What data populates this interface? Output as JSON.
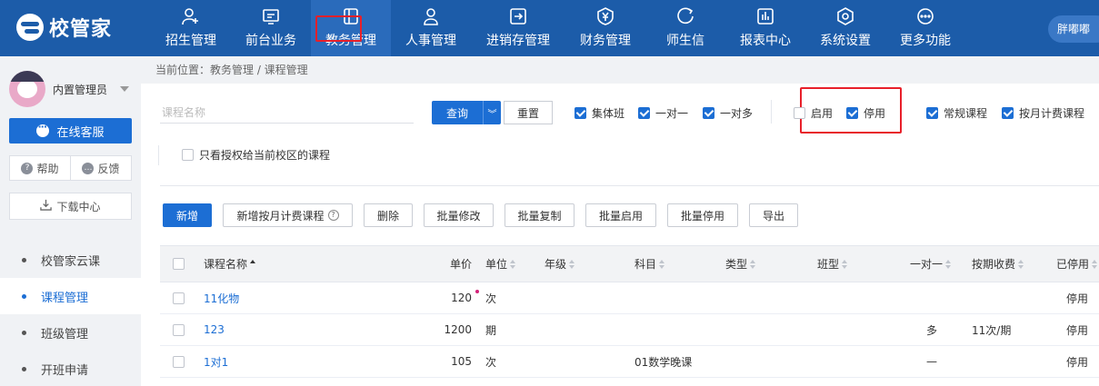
{
  "brand": {
    "name": "校管家"
  },
  "nav": {
    "items": [
      {
        "label": "招生管理",
        "icon": "person-add-icon"
      },
      {
        "label": "前台业务",
        "icon": "monitor-icon"
      },
      {
        "label": "教务管理",
        "icon": "book-icon",
        "active": true
      },
      {
        "label": "人事管理",
        "icon": "person-icon"
      },
      {
        "label": "进销存管理",
        "icon": "arrow-box-icon"
      },
      {
        "label": "财务管理",
        "icon": "yen-shield-icon"
      },
      {
        "label": "师生信",
        "icon": "chat-circle-icon"
      },
      {
        "label": "报表中心",
        "icon": "bar-chart-icon"
      },
      {
        "label": "系统设置",
        "icon": "gear-icon"
      },
      {
        "label": "更多功能",
        "icon": "more-icon"
      }
    ],
    "user": "胖嘟嘟"
  },
  "sidebar": {
    "profile_name": "内置管理员",
    "service": "在线客服",
    "help": "帮助",
    "feedback": "反馈",
    "download": "下载中心",
    "menu": [
      {
        "label": "校管家云课"
      },
      {
        "label": "课程管理",
        "active": true
      },
      {
        "label": "班级管理"
      },
      {
        "label": "开班申请"
      }
    ]
  },
  "breadcrumb": "当前位置：教务管理 / 课程管理",
  "filters": {
    "search_placeholder": "课程名称",
    "query": "查询",
    "reset": "重置",
    "types": [
      {
        "label": "集体班",
        "checked": true
      },
      {
        "label": "一对一",
        "checked": true
      },
      {
        "label": "一对多",
        "checked": true
      }
    ],
    "status": [
      {
        "label": "启用",
        "checked": false
      },
      {
        "label": "停用",
        "checked": true
      }
    ],
    "billing": [
      {
        "label": "常规课程",
        "checked": true
      },
      {
        "label": "按月计费课程",
        "checked": true
      }
    ],
    "only_authorized": "只看授权给当前校区的课程"
  },
  "toolbar": {
    "add": "新增",
    "add_monthly": "新增按月计费课程",
    "delete": "删除",
    "batch_edit": "批量修改",
    "batch_copy": "批量复制",
    "batch_enable": "批量启用",
    "batch_disable": "批量停用",
    "export": "导出"
  },
  "table": {
    "headers": {
      "name": "课程名称",
      "price": "单价",
      "unit": "单位",
      "grade": "年级",
      "subject": "科目",
      "type": "类型",
      "class_type": "班型",
      "one_to_one": "一对一",
      "period_fee": "按期收费",
      "disabled": "已停用"
    },
    "rows": [
      {
        "name": "11化物",
        "price": "120",
        "unit": "次",
        "grade": "",
        "subject": "",
        "type": "",
        "class_type": "",
        "one_to_one": "",
        "period_fee": "",
        "disabled": "停用"
      },
      {
        "name": "123",
        "price": "1200",
        "unit": "期",
        "grade": "",
        "subject": "",
        "type": "",
        "class_type": "",
        "one_to_one": "多",
        "period_fee": "11次/期",
        "disabled": "停用"
      },
      {
        "name": "1对1",
        "price": "105",
        "unit": "次",
        "grade": "",
        "subject": "01数学晚课",
        "type": "",
        "class_type": "",
        "one_to_one": "—",
        "period_fee": "",
        "disabled": "停用"
      }
    ]
  }
}
